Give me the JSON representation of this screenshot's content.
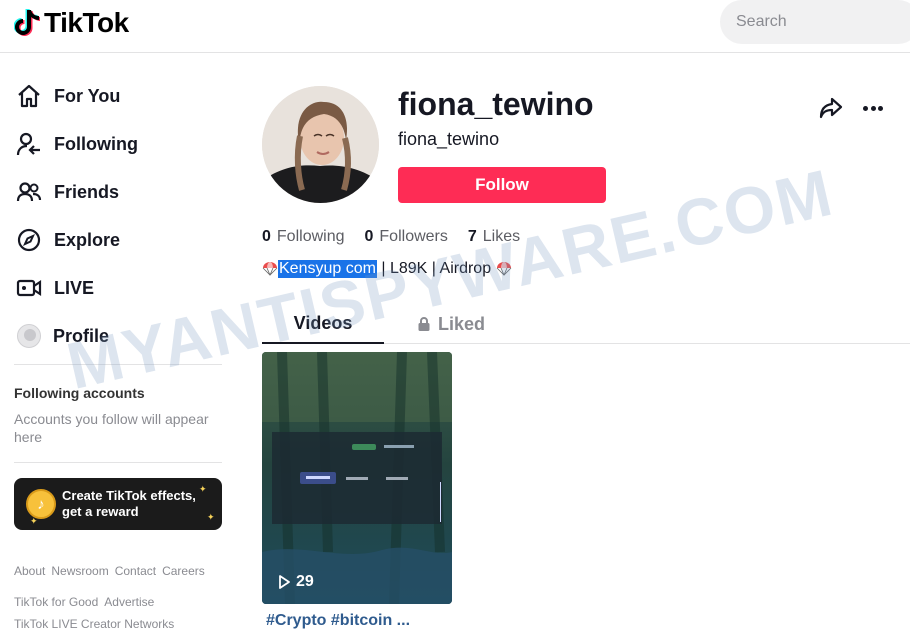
{
  "header": {
    "logo_text": "TikTok",
    "search_placeholder": "Search"
  },
  "sidebar": {
    "nav": [
      {
        "label": "For You",
        "icon": "home-icon"
      },
      {
        "label": "Following",
        "icon": "following-icon"
      },
      {
        "label": "Friends",
        "icon": "friends-icon"
      },
      {
        "label": "Explore",
        "icon": "compass-icon"
      },
      {
        "label": "LIVE",
        "icon": "live-icon"
      },
      {
        "label": "Profile",
        "icon": "avatar"
      }
    ],
    "following_title": "Following accounts",
    "following_desc": "Accounts you follow will appear here",
    "effects_line1": "Create TikTok effects,",
    "effects_line2": "get a reward",
    "footer_row1": [
      "About",
      "Newsroom",
      "Contact",
      "Careers"
    ],
    "footer_row2": [
      "TikTok for Good",
      "Advertise"
    ],
    "footer_row3": "TikTok LIVE Creator Networks"
  },
  "profile": {
    "username": "fiona_tewino",
    "nickname": "fiona_tewino",
    "follow_label": "Follow",
    "stats": [
      {
        "num": "0",
        "label": "Following"
      },
      {
        "num": "0",
        "label": "Followers"
      },
      {
        "num": "7",
        "label": "Likes"
      }
    ],
    "bio_highlight": "Kensyup com",
    "bio_rest": " | L89K | Airdrop "
  },
  "tabs": {
    "videos": "Videos",
    "liked": "Liked"
  },
  "video": {
    "views": "29",
    "caption": "#Crypto #bitcoin ..."
  },
  "watermark": "MYANTISPYWARE.COM",
  "colors": {
    "accent": "#fe2c55",
    "highlight": "#1a73e8"
  }
}
